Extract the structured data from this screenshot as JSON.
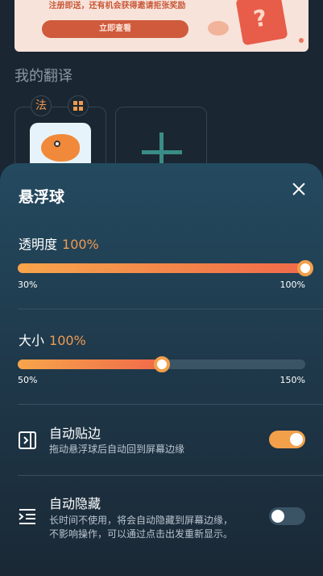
{
  "background": {
    "banner": {
      "text": "注册即送，还有机会获得邀请拒张奖励",
      "button_label": "立即查看"
    },
    "section_title": "我的翻译",
    "card_chips": [
      "法",
      "apps-grid-icon"
    ],
    "add_card_icon": "plus-icon"
  },
  "sheet": {
    "title": "悬浮球",
    "close_icon": "close-icon",
    "opacity": {
      "label": "透明度",
      "value_text": "100%",
      "min_label": "30%",
      "max_label": "100%",
      "level_percent": 100
    },
    "size": {
      "label": "大小",
      "value_text": "100%",
      "min_label": "50%",
      "max_label": "150%",
      "level_percent": 50
    },
    "auto_snap": {
      "title": "自动贴边",
      "description": "拖动悬浮球后自动回到屏幕边缘",
      "enabled": true,
      "icon": "snap-edge-icon"
    },
    "auto_hide": {
      "title": "自动隐藏",
      "description_line1": "长时间不使用，将会自动隐藏到屏幕边缘，",
      "description_line2": "不影响操作，可以通过点击出发重新显示。",
      "enabled": false,
      "icon": "auto-hide-icon"
    }
  },
  "colors": {
    "accent": "#f09a51",
    "sheet_bg": "#244a60",
    "track": "#3a5466"
  }
}
